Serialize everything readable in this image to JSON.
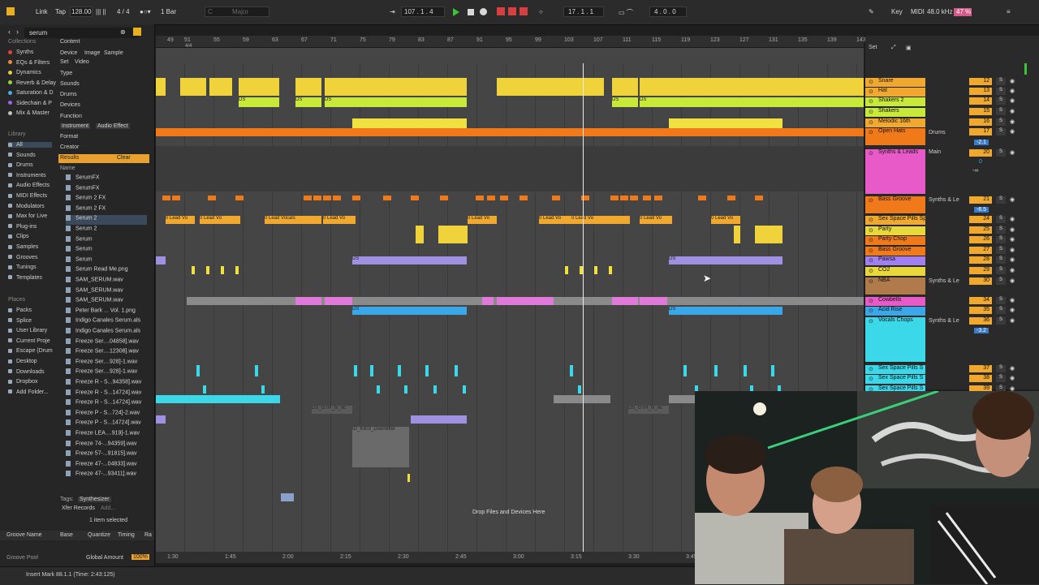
{
  "topbar": {
    "link": "Link",
    "tap": "Tap",
    "tempo": "128.00",
    "signature": "4 / 4",
    "quantize": "1 Bar",
    "key_root": "C",
    "key_scale": "Major",
    "position": "107 .  1 .  4",
    "loop_start": "17 .  1 .  1",
    "loop_len": "4 .  0 .  0",
    "key_label": "Key",
    "midi_label": "MIDI",
    "sample_rate": "48.0 kHz",
    "cpu": "47 %"
  },
  "browser": {
    "search_value": "serum",
    "collections_title": "Collections",
    "collections": [
      {
        "label": "Synths",
        "color": "#e84040"
      },
      {
        "label": "EQs & Filters",
        "color": "#e88a40"
      },
      {
        "label": "Dynamics",
        "color": "#e8c840"
      },
      {
        "label": "Reverb & Delay",
        "color": "#9ad040"
      },
      {
        "label": "Saturation & D",
        "color": "#40b0e8"
      },
      {
        "label": "Sidechain & P",
        "color": "#a060e8"
      },
      {
        "label": "Mix & Master",
        "color": "#c0c0c0"
      }
    ],
    "library_title": "Library",
    "library": [
      "All",
      "Sounds",
      "Drums",
      "Instruments",
      "Audio Effects",
      "MIDI Effects",
      "Modulators",
      "Max for Live",
      "Plug-ins",
      "Clips",
      "Samples",
      "Grooves",
      "Tunings",
      "Templates"
    ],
    "places_title": "Places",
    "places": [
      "Packs",
      "Splice",
      "User Library",
      "Current Proje",
      "Escape (Drum",
      "Desktop",
      "Downloads",
      "Dropbox",
      "Add Folder..."
    ],
    "filters": {
      "content": "Content",
      "tabs": [
        "Device",
        "Image",
        "Sample",
        "Set",
        "Video"
      ],
      "type": "Type",
      "sounds": "Sounds",
      "drums": "Drums",
      "devices": "Devices",
      "function": "Function",
      "fn_tabs": [
        "Instrument",
        "Audio Effect"
      ],
      "format": "Format",
      "creator": "Creator"
    },
    "results_label": "Results",
    "clear_label": "Clear",
    "name_header": "Name",
    "results": [
      "SerumFX",
      "SerumFX",
      "Serum 2 FX",
      "Serum 2 FX",
      "Serum 2",
      "Serum 2",
      "Serum",
      "Serum",
      "Serum",
      "Serum Read Me.png",
      "SAM_SERUM.wav",
      "SAM_SERUM.wav",
      "SAM_SERUM.wav",
      "Peter Bark ... Vol. 1.png",
      "Indigo Canales Serum.als",
      "Indigo Canales Serum.als",
      "Freeze Ser....04858].wav",
      "Freeze Ser....12308].wav",
      "Freeze Ser....928]-1.wav",
      "Freeze Ser....928]-1.wav",
      "Freeze R - S...94358].wav",
      "Freeze R - S...14724].wav",
      "Freeze R - S...14724].wav",
      "Freeze P - S...724]-2.wav",
      "Freeze P - S...14724].wav",
      "Freeze LEA....919]-1.wav",
      "Freeze 74-...94359].wav",
      "Freeze 57-...91815].wav",
      "Freeze 47-...04833].wav",
      "Freeze 47-...93411].wav"
    ],
    "tags_label": "Tags:",
    "tag_value": "Synthesizer",
    "tag_value2": "Xfer Records",
    "tag_add": "Add...",
    "selected_info": "1 item selected",
    "groove_cols": [
      "Groove Name",
      "Base",
      "Quantize",
      "Timing",
      "Ra"
    ],
    "groove_pool": "Groove Pool",
    "global_amount_label": "Global Amount",
    "global_amount": "100%"
  },
  "arrangement": {
    "bars": [
      "49",
      "51",
      "55",
      "59",
      "63",
      "67",
      "71",
      "75",
      "79",
      "83",
      "87",
      "91",
      "95",
      "99",
      "103",
      "107",
      "111",
      "115",
      "119",
      "123",
      "127",
      "131",
      "135",
      "139",
      "143"
    ],
    "signature_marker": "4/4",
    "times": [
      "1:30",
      "1:45",
      "2:00",
      "2:15",
      "2:30",
      "2:45",
      "3:00",
      "3:15",
      "3:30",
      "3:45"
    ],
    "drop_hint": "Drop Files and Devices Here",
    "clip_labels": {
      "ds": "DS",
      "lead": "0 Lead Vo",
      "lead_vocals": "0 Lead Vocals",
      "ds_gth": "DS_GTH_fx_ric",
      "downlifter": "ID_Kit03_Downlifter"
    }
  },
  "mixer": {
    "set_label": "Set",
    "tracks": [
      {
        "name": "Snare",
        "num": "12",
        "color": "#f0a92e"
      },
      {
        "name": "Hat",
        "num": "13",
        "color": "#f0a92e"
      },
      {
        "name": "Shakers 2",
        "num": "14",
        "color": "#c8e83a"
      },
      {
        "name": "Shakers",
        "num": "15",
        "color": "#c8e83a"
      },
      {
        "name": "Melodic 16th",
        "num": "16",
        "color": "#f0a92e"
      },
      {
        "name": "Open Hats",
        "num": "17",
        "color": "#f07a1a"
      },
      {
        "name": "Synths & Leads",
        "num": "20",
        "color": "#e85ac8"
      },
      {
        "name": "Bass Groove",
        "num": "21",
        "color": "#f07a1a"
      },
      {
        "name": "Sex Space Pills Sp",
        "num": "24",
        "color": "#f0a92e"
      },
      {
        "name": "Party",
        "num": "25",
        "color": "#e8d83a"
      },
      {
        "name": "Party Chop",
        "num": "26",
        "color": "#f07a1a"
      },
      {
        "name": "Bass Groove",
        "num": "27",
        "color": "#f07a1a"
      },
      {
        "name": "Pawsa",
        "num": "28",
        "color": "#a080f0"
      },
      {
        "name": "CO2",
        "num": "29",
        "color": "#e8d83a"
      },
      {
        "name": "NBA",
        "num": "30",
        "color": "#b07a4a"
      },
      {
        "name": "Cowbells",
        "num": "34",
        "color": "#e85ac8"
      },
      {
        "name": "Acid Rise",
        "num": "35",
        "color": "#3aa8e8"
      },
      {
        "name": "Vocals Chops",
        "num": "36",
        "color": "#3ad8e8"
      },
      {
        "name": "Sex Space Pills S",
        "num": "37",
        "color": "#3ad8e8"
      },
      {
        "name": "Sex Space Pills S",
        "num": "38",
        "color": "#3ad8e8"
      },
      {
        "name": "Sex Space Pills S",
        "num": "39",
        "color": "#3ad8e8"
      }
    ],
    "routing": {
      "drums": "Drums",
      "main": "Main",
      "synths_leads": "Synths & Le"
    },
    "levels": {
      "a": "-2.1",
      "b": "0",
      "c": "-∞",
      "d": "-6.5",
      "e": "-3.2"
    },
    "solo": "S",
    "cue": "C"
  },
  "status": {
    "text": "Insert Mark 88.1.1 (Time: 2:43:125)"
  }
}
